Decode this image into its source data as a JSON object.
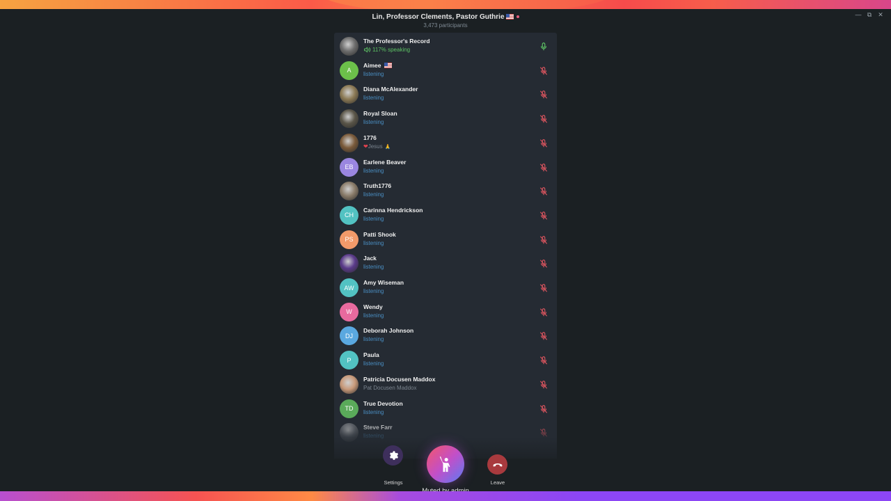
{
  "window": {
    "title": "Lin, Professor Clements, Pastor Guthrie",
    "subtitle": "3,473 participants",
    "controls": [
      "minimize",
      "restore",
      "close"
    ]
  },
  "participants": [
    {
      "name": "The Professor's Record",
      "status": "117% speaking",
      "status_type": "speaking",
      "avatar": {
        "type": "photo",
        "color": "#6d6d6d"
      },
      "mic": "active"
    },
    {
      "name": "Aimee",
      "flag": true,
      "status": "listening",
      "status_type": "listening",
      "avatar": {
        "type": "initials",
        "initials": "A",
        "color": "#6cc04a"
      },
      "mic": "muted"
    },
    {
      "name": "Diana McAlexander",
      "status": "listening",
      "status_type": "listening",
      "avatar": {
        "type": "photo",
        "color": "#8c7a55"
      },
      "mic": "muted"
    },
    {
      "name": "Royal Sloan",
      "status": "listening",
      "status_type": "listening",
      "avatar": {
        "type": "photo",
        "color": "#5a5548"
      },
      "mic": "muted"
    },
    {
      "name": "1776",
      "status": "Jesus",
      "status_prefix": "❤",
      "status_suffix": "🙏",
      "status_type": "about",
      "avatar": {
        "type": "photo",
        "color": "#7a5a3a"
      },
      "mic": "muted"
    },
    {
      "name": "Earlene Beaver",
      "status": "listening",
      "status_type": "listening",
      "avatar": {
        "type": "initials",
        "initials": "EB",
        "color": "#9a86e0"
      },
      "mic": "muted"
    },
    {
      "name": "Truth1776",
      "status": "listening",
      "status_type": "listening",
      "avatar": {
        "type": "photo",
        "color": "#8a7c6a"
      },
      "mic": "muted"
    },
    {
      "name": "Carinna Hendrickson",
      "status": "listening",
      "status_type": "listening",
      "avatar": {
        "type": "initials",
        "initials": "CH",
        "color": "#52c2c2"
      },
      "mic": "muted"
    },
    {
      "name": "Patti Shook",
      "status": "listening",
      "status_type": "listening",
      "avatar": {
        "type": "initials",
        "initials": "PS",
        "color": "#f29a6a"
      },
      "mic": "muted"
    },
    {
      "name": "Jack",
      "status": "listening",
      "status_type": "listening",
      "avatar": {
        "type": "photo",
        "color": "#5a3a8a"
      },
      "mic": "muted"
    },
    {
      "name": "Amy Wiseman",
      "status": "listening",
      "status_type": "listening",
      "avatar": {
        "type": "initials",
        "initials": "AW",
        "color": "#52c2c2"
      },
      "mic": "muted"
    },
    {
      "name": "Wendy",
      "status": "listening",
      "status_type": "listening",
      "avatar": {
        "type": "initials",
        "initials": "W",
        "color": "#e86a9e"
      },
      "mic": "muted"
    },
    {
      "name": "Deborah Johnson",
      "status": "listening",
      "status_type": "listening",
      "avatar": {
        "type": "initials",
        "initials": "DJ",
        "color": "#5aa8e0"
      },
      "mic": "muted"
    },
    {
      "name": "Paula",
      "status": "listening",
      "status_type": "listening",
      "avatar": {
        "type": "initials",
        "initials": "P",
        "color": "#52c2c2"
      },
      "mic": "muted"
    },
    {
      "name": "Patricia Docusen Maddox",
      "status": "Pat Docusen Maddox",
      "status_type": "about",
      "avatar": {
        "type": "photo",
        "color": "#c89a7a"
      },
      "mic": "muted"
    },
    {
      "name": "True Devotion",
      "status": "listening",
      "status_type": "listening",
      "avatar": {
        "type": "initials",
        "initials": "TD",
        "color": "#5aaa5a"
      },
      "mic": "muted"
    },
    {
      "name": "Steve Farr",
      "status": "listening",
      "status_type": "listening",
      "avatar": {
        "type": "photo",
        "color": "#6a6e74"
      },
      "mic": "muted"
    }
  ],
  "controls": {
    "settings_label": "Settings",
    "main_label": "Muted by admin",
    "leave_label": "Leave"
  },
  "colors": {
    "speaking": "#5dc264",
    "listening": "#4a8fc4",
    "muted_mic": "#d9545e",
    "settings_bg": "#3e2f5c",
    "leave_bg": "#a83a3e"
  }
}
